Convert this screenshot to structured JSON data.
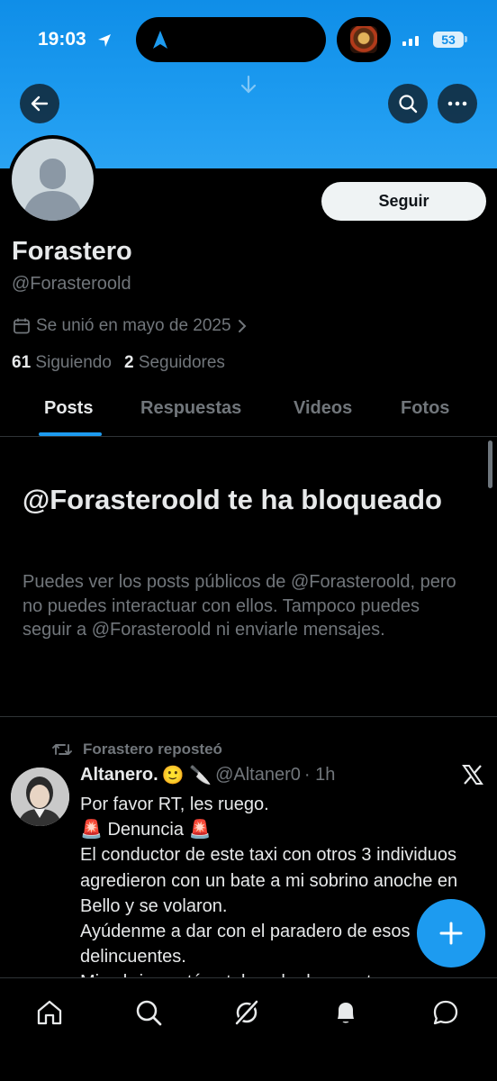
{
  "status_bar": {
    "time": "19:03",
    "battery": "53"
  },
  "colors": {
    "accent": "#1d9bf0",
    "banner": "#1d9bf0",
    "background": "#000000",
    "muted": "#71767b",
    "text": "#e7e9ea"
  },
  "profile": {
    "name": "Forastero",
    "handle": "@Forasteroold",
    "joined": "Se unió en mayo de 2025",
    "following_count": "61",
    "following_label": "Siguiendo",
    "followers_count": "2",
    "followers_label": "Seguidores",
    "follow_label": "Seguir"
  },
  "tabs": [
    {
      "label": "Posts",
      "active": true
    },
    {
      "label": "Respuestas",
      "active": false
    },
    {
      "label": "Videos",
      "active": false
    },
    {
      "label": "Fotos",
      "active": false
    }
  ],
  "blocked": {
    "title": "@Forasteroold te ha bloqueado",
    "description": "Puedes ver los posts públicos de @Forasteroold, pero no puedes interactuar con ellos. Tampoco puedes seguir a @Forasteroold ni enviarle mensajes."
  },
  "post": {
    "repost_label": "Forastero reposteó",
    "author": "Altanero.",
    "author_emoji": "🙂 🔪",
    "handle": "@Altaner0",
    "time": "· 1h",
    "text": "Por favor RT, les ruego.\n🚨 Denuncia 🚨\nEl conductor de este taxi con otros 3 individuos agredieron con un bate a mi sobrino anoche en Bello y se volaron.\nAyúdenme a dar con el paradero de esos delincuentes.\nMi sobrino está catalogado de muerto en"
  },
  "icons": {
    "back": "arrow-left-icon",
    "search": "search-icon",
    "more": "more-icon",
    "calendar": "calendar-icon",
    "repost": "repost-icon",
    "x": "x-logo-icon",
    "compose": "plus-icon",
    "nav": [
      "home-icon",
      "search-icon",
      "grok-icon",
      "bell-icon",
      "message-icon"
    ]
  }
}
